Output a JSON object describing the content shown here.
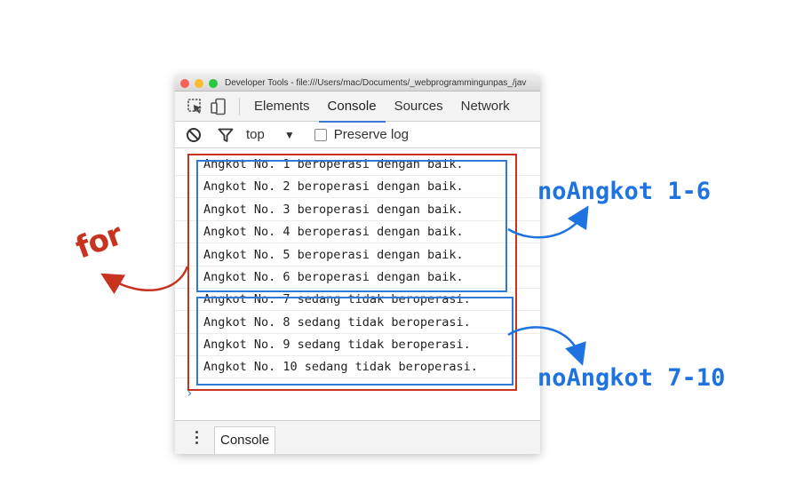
{
  "window": {
    "title": "Developer Tools - file:///Users/mac/Documents/_webprogrammingunpas_/jav"
  },
  "toolbar": {
    "inspect_icon": "inspect-element-icon",
    "device_icon": "device-toolbar-icon",
    "tabs": [
      "Elements",
      "Console",
      "Sources",
      "Network"
    ],
    "active_tab": "Console"
  },
  "filter": {
    "clear_icon": "clear-console-icon",
    "filter_icon": "filter-icon",
    "context": "top",
    "preserve_log_label": "Preserve log",
    "preserve_log_checked": false
  },
  "console": {
    "lines": [
      "Angkot No. 1 beroperasi dengan baik.",
      "Angkot No. 2 beroperasi dengan baik.",
      "Angkot No. 3 beroperasi dengan baik.",
      "Angkot No. 4 beroperasi dengan baik.",
      "Angkot No. 5 beroperasi dengan baik.",
      "Angkot No. 6 beroperasi dengan baik.",
      "Angkot No. 7 sedang tidak beroperasi.",
      "Angkot No. 8 sedang tidak beroperasi.",
      "Angkot No. 9 sedang tidak beroperasi.",
      "Angkot No. 10 sedang tidak beroperasi."
    ],
    "prompt": "›"
  },
  "drawer": {
    "menu_icon": "more-options-icon",
    "tab_label": "Console"
  },
  "annotations": {
    "loop_label": "for",
    "group1_label": "noAngkot 1-6",
    "group2_label": "noAngkot 7-10",
    "red_color": "#c8331f",
    "blue_color": "#1e73e0"
  }
}
